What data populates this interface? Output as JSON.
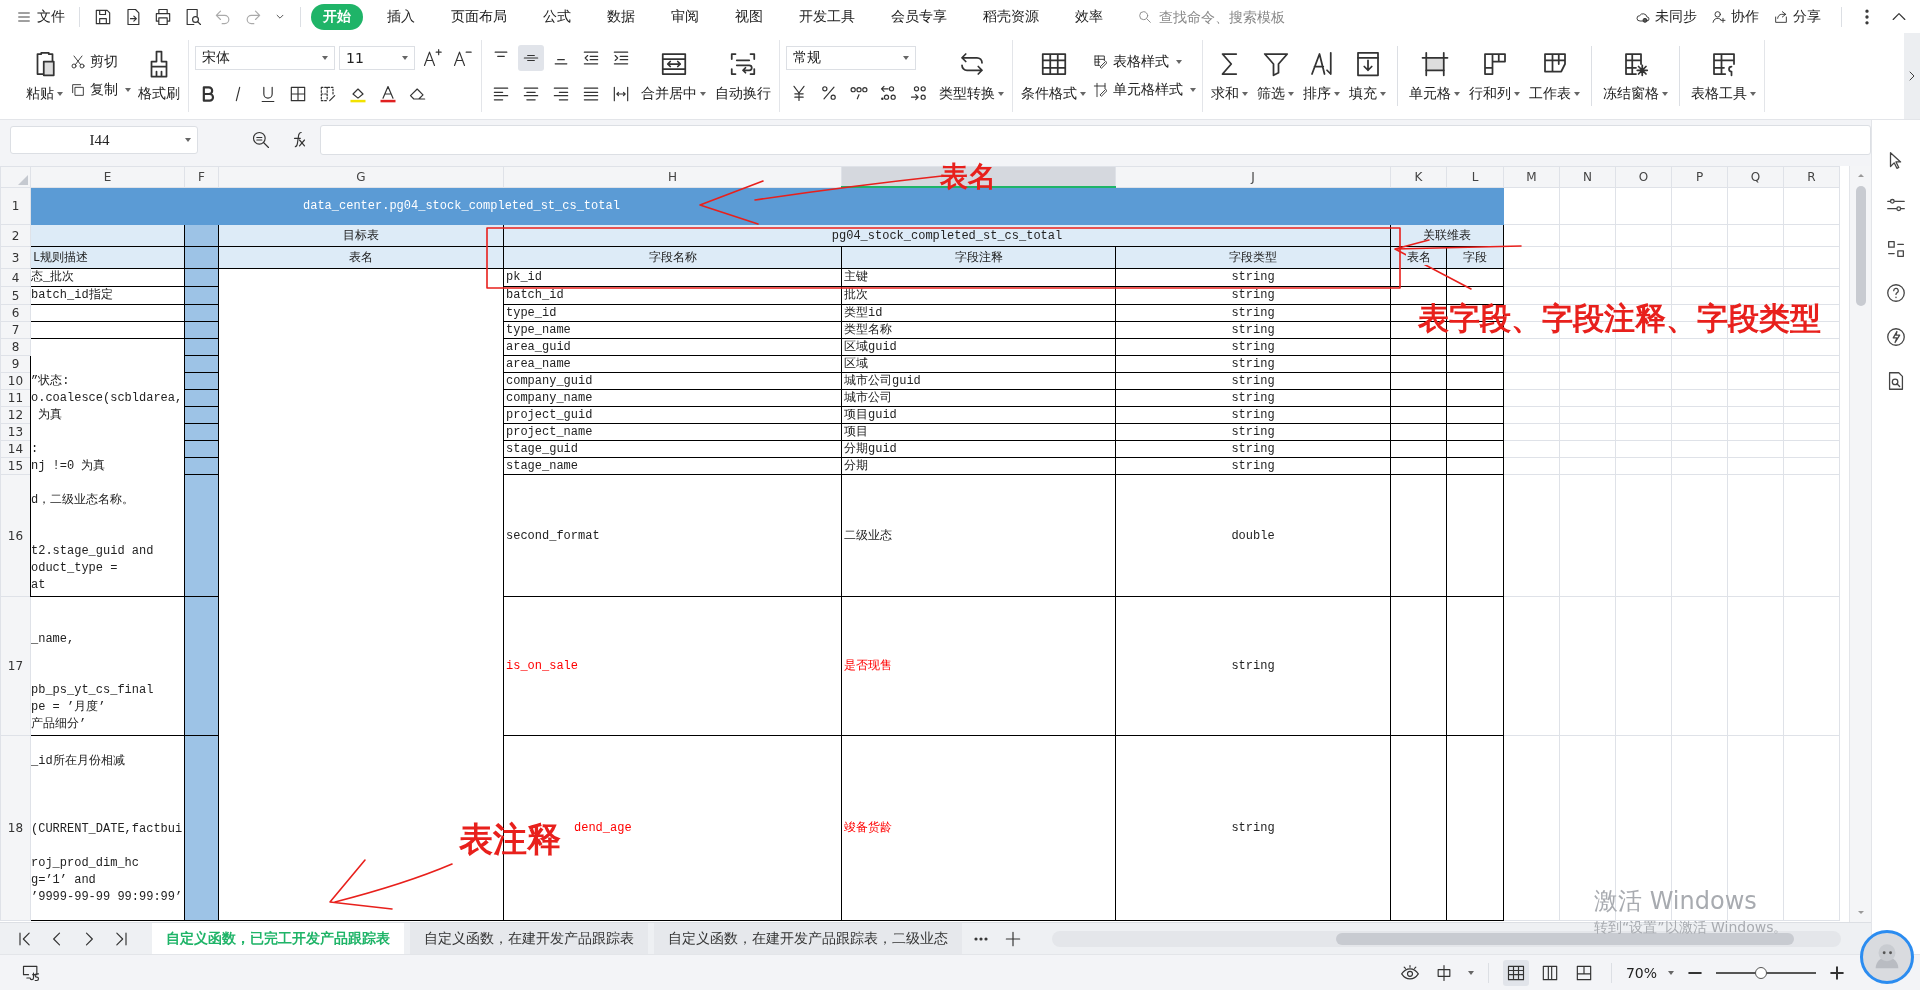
{
  "menu": {
    "file": "文件",
    "tabs": [
      {
        "label": "开始",
        "selected": true
      },
      {
        "label": "插入",
        "selected": false
      },
      {
        "label": "页面布局",
        "selected": false
      },
      {
        "label": "公式",
        "selected": false
      },
      {
        "label": "数据",
        "selected": false
      },
      {
        "label": "审阅",
        "selected": false
      },
      {
        "label": "视图",
        "selected": false
      },
      {
        "label": "开发工具",
        "selected": false
      },
      {
        "label": "会员专享",
        "selected": false
      },
      {
        "label": "稻壳资源",
        "selected": false
      },
      {
        "label": "效率",
        "selected": false
      }
    ],
    "search_placeholder": "查找命令、搜索模板",
    "actions": [
      "未同步",
      "协作",
      "分享"
    ]
  },
  "ribbon": {
    "paste": "粘贴",
    "cut": "剪切",
    "copy": "复制",
    "format_painter": "格式刷",
    "font": "宋体",
    "font_size": "11",
    "merge": "合并居中",
    "wrap": "自动换行",
    "number_format": "常规",
    "convert": "类型转换",
    "conditional": "条件格式",
    "styles": [
      "表格样式",
      "单元格样式"
    ],
    "tools": [
      "求和",
      "筛选",
      "排序",
      "填充",
      "单元格",
      "行和列",
      "工作表",
      "冻结窗格",
      "表格工具"
    ]
  },
  "formula_bar": {
    "name_box": "I44"
  },
  "sheet": {
    "columns": [
      {
        "label": "E",
        "selected": false
      },
      {
        "label": "F",
        "selected": false
      },
      {
        "label": "G",
        "selected": false
      },
      {
        "label": "H",
        "selected": false
      },
      {
        "selected": true
      },
      {
        "label": "J",
        "selected": false
      },
      {
        "label": "K",
        "selected": false
      },
      {
        "label": "L",
        "selected": false
      },
      {
        "label": "M",
        "selected": false
      },
      {
        "label": "N",
        "selected": false
      },
      {
        "label": "O",
        "selected": false
      },
      {
        "label": "P",
        "selected": false
      },
      {
        "label": "Q",
        "selected": false
      },
      {
        "label": "R",
        "selected": false
      }
    ],
    "header_rows": [
      "1",
      "2",
      "3"
    ],
    "title": "data_center.pg04_stock_completed_st_cs_total",
    "target_group": "目标表",
    "table_group": "pg04_stock_completed_st_cs_total",
    "dim_group": "关联维表",
    "headers": [
      "L规则描述",
      "表名",
      "字段名称",
      "字段注释",
      "字段类型",
      "表名",
      "字段"
    ],
    "fields": [
      {
        "row": "4",
        "rule": "态_批次",
        "name": "pk_id",
        "comment": "主键",
        "type": "string",
        "highlighted": false
      },
      {
        "row": "5",
        "rule": "batch_id指定",
        "name": "batch_id",
        "comment": "批次",
        "type": "string",
        "highlighted": false
      },
      {
        "row": "6",
        "name": "type_id",
        "comment": "类型id",
        "type": "string",
        "highlighted": false
      },
      {
        "row": "7",
        "name": "type_name",
        "comment": "类型名称",
        "type": "string",
        "highlighted": false
      },
      {
        "row": "8",
        "rule": "\n\n”状态:\no.coalesce(scbldarea,\n 为真\n\n:\nnj !=0 为真\n\nd，二级业态名称。\n\n\nt2.stage_guid and\noduct_type =\nat",
        "name": "area_guid",
        "comment": "区域guid",
        "type": "string",
        "highlighted": false
      },
      {
        "row": "9",
        "name": "area_name",
        "comment": "区域",
        "type": "string",
        "highlighted": false
      },
      {
        "row": "10",
        "name": "company_guid",
        "comment": "城市公司guid",
        "type": "string",
        "highlighted": false
      },
      {
        "row": "11",
        "name": "company_name",
        "comment": "城市公司",
        "type": "string",
        "highlighted": false
      },
      {
        "row": "12",
        "name": "project_guid",
        "comment": "项目guid",
        "type": "string",
        "highlighted": false
      },
      {
        "row": "13",
        "name": "project_name",
        "comment": "项目",
        "type": "string",
        "highlighted": false
      },
      {
        "row": "14",
        "name": "stage_guid",
        "comment": "分期guid",
        "type": "string",
        "highlighted": false
      },
      {
        "row": "15",
        "name": "stage_name",
        "comment": "分期",
        "type": "string",
        "highlighted": false
      },
      {
        "row": "16",
        "name": "second_format",
        "comment": "二级业态",
        "type": "double",
        "highlighted": false
      },
      {
        "row": "17",
        "rule": "\n\n_name,\n\n\npb_ps_yt_cs_final\npe = ’月度’\n产品细分’",
        "name": "is_on_sale",
        "comment": "是否现售",
        "type": "string",
        "highlighted": true
      },
      {
        "row": "18",
        "rule": "\n_id所在月份相减\n\n\n\n(CURRENT_DATE,factbui\n\nroj_prod_dim_hc\ng=’1’ and\n’9999-99-99 99:99:99’",
        "name": "dend_age",
        "comment": "竣备货龄",
        "type": "string",
        "highlighted": true,
        "partly_covered": true
      }
    ]
  },
  "annotations": [
    "表名",
    "表字段、字段注释、字段类型",
    "表注释"
  ],
  "sheet_tabs": [
    {
      "label": "自定义函数，已完工开发产品跟踪表",
      "selected": true
    },
    {
      "label": "自定义函数，在建开发产品跟踪表",
      "selected": false
    },
    {
      "label": "自定义函数，在建开发产品跟踪表，二级业态",
      "selected": false
    }
  ],
  "status": {
    "zoom": "70%",
    "zoom_slider": {
      "level": 0.45
    }
  },
  "activation": {
    "title": "激活 Windows",
    "hint": "转到“设置”以激活 Windows。"
  }
}
